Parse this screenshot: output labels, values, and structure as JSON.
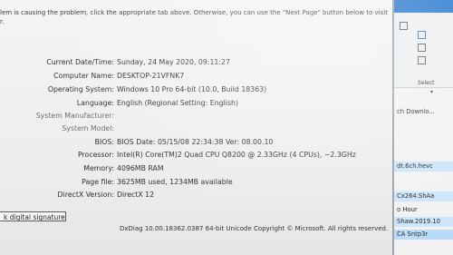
{
  "intro": {
    "line1": "lem is causing the problem, click the appropriate tab above.  Otherwise, you can use the \"Next Page\" button below to visit",
    "line2": "r."
  },
  "system_info": [
    {
      "label": "Current Date/Time:",
      "value": "Sunday, 24 May 2020, 09:11:27"
    },
    {
      "label": "Computer Name:",
      "value": "DESKTOP-21VFNK7"
    },
    {
      "label": "Operating System:",
      "value": "Windows 10 Pro 64-bit (10.0, Build 18363)"
    },
    {
      "label": "Language:",
      "value": "English (Regional Setting: English)"
    },
    {
      "label": "System Manufacturer:",
      "value": ""
    },
    {
      "label": "System Model:",
      "value": ""
    },
    {
      "label": "BIOS:",
      "value": "BIOS Date: 05/15/08 22:34:38 Ver: 08.00.10"
    },
    {
      "label": "Processor:",
      "value": "Intel(R) Core(TM)2 Quad  CPU   Q8200  @ 2.33GHz (4 CPUs), ~2.3GHz"
    },
    {
      "label": "Memory:",
      "value": "4096MB RAM"
    },
    {
      "label": "Page file:",
      "value": "3625MB used, 1234MB available"
    },
    {
      "label": "DirectX Version:",
      "value": "DirectX 12"
    }
  ],
  "signatures_label": "k digital signatures",
  "footer": "DxDiag 10.00.18362.0387 64-bit Unicode  Copyright © Microsoft. All rights reserved.",
  "side": {
    "select_label": "Select",
    "files": [
      "ch Downlo...",
      "dt.6ch.hevc",
      "Cx264.ShAa",
      "o Hour",
      "Shaw.2019.10",
      "CA Sntp3r"
    ]
  }
}
